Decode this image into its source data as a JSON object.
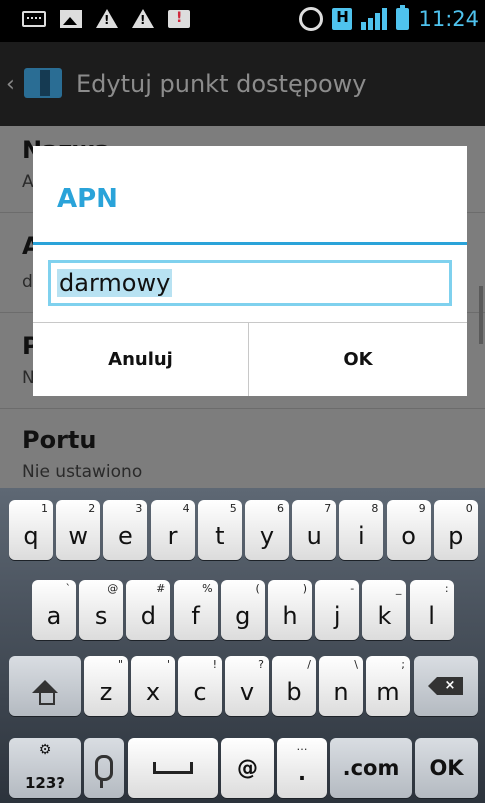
{
  "status_bar": {
    "time": "11:24",
    "network": "H"
  },
  "app_bar": {
    "back": "‹",
    "title": "Edytuj punkt dostępowy"
  },
  "settings_rows": [
    {
      "label": "Nazwa",
      "value": "A"
    },
    {
      "label": "A",
      "value": "d"
    },
    {
      "label": "P",
      "value": "N"
    },
    {
      "label": "Portu",
      "value": "Nie ustawiono"
    }
  ],
  "dialog": {
    "title": "APN",
    "input_value": "darmowy",
    "cancel_label": "Anuluj",
    "ok_label": "OK"
  },
  "keyboard": {
    "row1": [
      {
        "k": "q",
        "s": "1"
      },
      {
        "k": "w",
        "s": "2"
      },
      {
        "k": "e",
        "s": "3"
      },
      {
        "k": "r",
        "s": "4"
      },
      {
        "k": "t",
        "s": "5"
      },
      {
        "k": "y",
        "s": "6"
      },
      {
        "k": "u",
        "s": "7"
      },
      {
        "k": "i",
        "s": "8"
      },
      {
        "k": "o",
        "s": "9"
      },
      {
        "k": "p",
        "s": "0"
      }
    ],
    "row2": [
      {
        "k": "a",
        "s": "`"
      },
      {
        "k": "s",
        "s": "@"
      },
      {
        "k": "d",
        "s": "#"
      },
      {
        "k": "f",
        "s": "%"
      },
      {
        "k": "g",
        "s": "("
      },
      {
        "k": "h",
        "s": ")"
      },
      {
        "k": "j",
        "s": "-"
      },
      {
        "k": "k",
        "s": "_"
      },
      {
        "k": "l",
        "s": ":"
      }
    ],
    "row3": [
      {
        "k": "z",
        "s": "\""
      },
      {
        "k": "x",
        "s": "'"
      },
      {
        "k": "c",
        "s": "!"
      },
      {
        "k": "v",
        "s": "?"
      },
      {
        "k": "b",
        "s": "/"
      },
      {
        "k": "n",
        "s": "\\"
      },
      {
        "k": "m",
        "s": ";"
      }
    ],
    "sym_label": "123?",
    "at_label": "@",
    "dot_label": ".",
    "dot_sub": "…",
    "com_label": ".com",
    "ok_label": "OK",
    "backspace_label": "×"
  }
}
